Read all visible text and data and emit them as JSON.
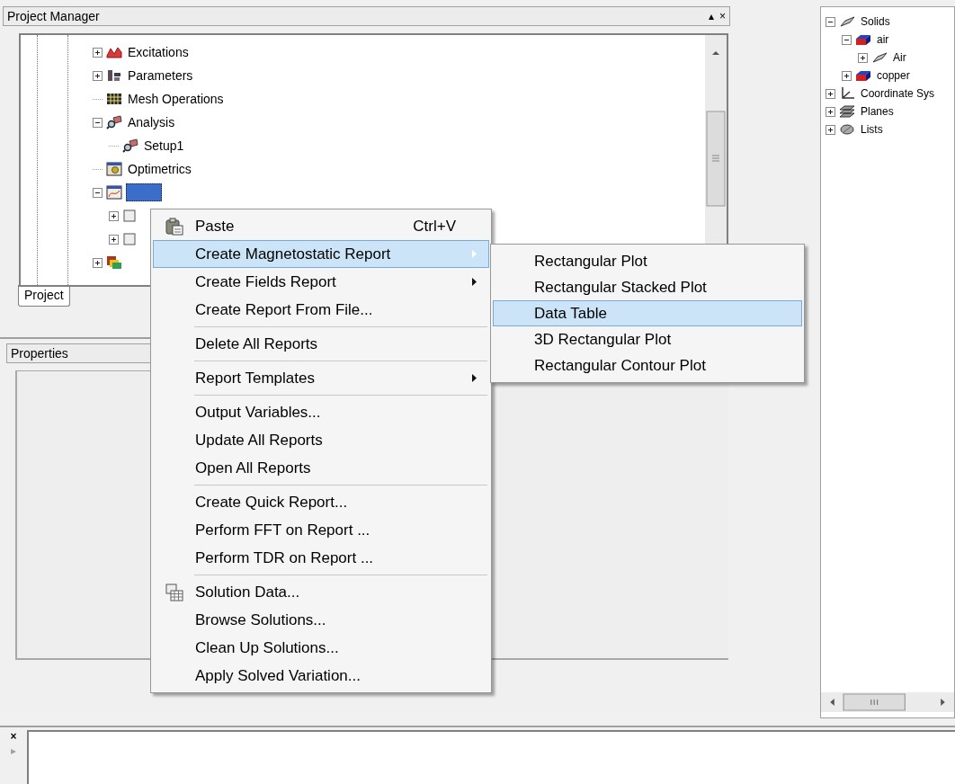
{
  "project_manager": {
    "title": "Project Manager",
    "header_buttons": [
      "▴",
      "×"
    ],
    "tree": [
      {
        "label": "Excitations",
        "kind": "excitations",
        "expanded": false,
        "selected": false
      },
      {
        "label": "Parameters",
        "kind": "parameters",
        "expanded": false,
        "selected": false
      },
      {
        "label": "Mesh Operations",
        "kind": "mesh",
        "selected": false
      },
      {
        "label": "Analysis",
        "kind": "analysis",
        "expanded": true,
        "selected": false,
        "children": [
          {
            "label": "Setup1",
            "kind": "analysis",
            "selected": false
          }
        ]
      },
      {
        "label": "Optimetrics",
        "kind": "optimetrics",
        "selected": false
      },
      {
        "kind": "results",
        "expanded": true,
        "selected": true,
        "children": [
          {
            "kind": "generic",
            "expanded": false,
            "selected": false
          },
          {
            "kind": "generic",
            "expanded": false,
            "selected": false
          }
        ]
      },
      {
        "kind": "overlays",
        "expanded": false,
        "selected": false
      }
    ],
    "tabs": [
      {
        "label": "Project",
        "selected": true
      }
    ]
  },
  "properties": {
    "title": "Properties"
  },
  "model_tree": [
    {
      "label": "Solids",
      "kind": "solid",
      "expanded": true,
      "selected": false,
      "children": [
        {
          "label": "air",
          "kind": "block",
          "expanded": true,
          "selected": false,
          "children": [
            {
              "label": "Air",
              "kind": "solid",
              "expanded": false,
              "selected": false
            }
          ]
        },
        {
          "label": "copper",
          "kind": "block",
          "expanded": false,
          "selected": false
        }
      ]
    },
    {
      "label": "Coordinate Sys",
      "kind": "axes",
      "expanded": false,
      "selected": false
    },
    {
      "label": "Planes",
      "kind": "planes",
      "expanded": false,
      "selected": false
    },
    {
      "label": "Lists",
      "kind": "lists",
      "expanded": false,
      "selected": false
    }
  ],
  "message_panel": {
    "buttons": [
      "×",
      "▸"
    ]
  },
  "context_menu": {
    "items": [
      {
        "kind": "paste",
        "label": "Paste",
        "shortcut": "Ctrl+V",
        "selected": false
      },
      {
        "kind": "item",
        "label": "Create Magnetostatic Report",
        "submenu": true,
        "selected": true
      },
      {
        "kind": "item",
        "label": "Create Fields Report",
        "submenu": true,
        "selected": false
      },
      {
        "kind": "item",
        "label": "Create Report From File...",
        "selected": false
      },
      {
        "kind": "separator"
      },
      {
        "kind": "item",
        "label": "Delete All Reports",
        "selected": false
      },
      {
        "kind": "separator"
      },
      {
        "kind": "item",
        "label": "Report Templates",
        "submenu": true,
        "selected": false
      },
      {
        "kind": "separator"
      },
      {
        "kind": "item",
        "label": "Output Variables...",
        "selected": false
      },
      {
        "kind": "item",
        "label": "Update All Reports",
        "selected": false
      },
      {
        "kind": "item",
        "label": "Open All Reports",
        "selected": false
      },
      {
        "kind": "separator"
      },
      {
        "kind": "item",
        "label": "Create Quick Report...",
        "selected": false
      },
      {
        "kind": "item",
        "label": "Perform FFT on Report ...",
        "selected": false
      },
      {
        "kind": "item",
        "label": "Perform TDR on Report ...",
        "selected": false
      },
      {
        "kind": "separator"
      },
      {
        "kind": "data",
        "label": "Solution Data...",
        "selected": false
      },
      {
        "kind": "item",
        "label": "Browse Solutions...",
        "selected": false
      },
      {
        "kind": "item",
        "label": "Clean Up Solutions...",
        "selected": false
      },
      {
        "kind": "item",
        "label": "Apply Solved Variation...",
        "selected": false
      }
    ]
  },
  "submenu": {
    "items": [
      {
        "label": "Rectangular Plot",
        "selected": false
      },
      {
        "label": "Rectangular Stacked Plot",
        "selected": false
      },
      {
        "label": "Data Table",
        "selected": true
      },
      {
        "label": "3D Rectangular Plot",
        "selected": false
      },
      {
        "label": "Rectangular Contour Plot",
        "selected": false
      }
    ]
  }
}
